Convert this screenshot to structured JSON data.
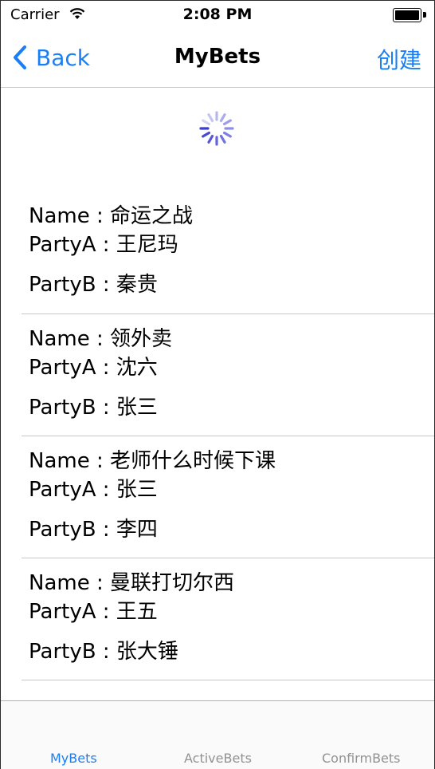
{
  "status_bar": {
    "carrier": "Carrier",
    "time": "2:08 PM",
    "wifi_icon": "wifi-icon",
    "battery_icon": "battery-icon"
  },
  "nav": {
    "back_label": "Back",
    "title": "MyBets",
    "action_label": "创建",
    "tint_color": "#1a7ff5"
  },
  "bets": [
    {
      "name_line": "Name : 命运之战",
      "party_a_line": "PartyA : 王尼玛",
      "party_b_line": "PartyB : 秦贵"
    },
    {
      "name_line": "Name : 领外卖",
      "party_a_line": "PartyA : 沈六",
      "party_b_line": "PartyB : 张三"
    },
    {
      "name_line": "Name : 老师什么时候下课",
      "party_a_line": "PartyA : 张三",
      "party_b_line": "PartyB : 李四"
    },
    {
      "name_line": "Name : 曼联打切尔西",
      "party_a_line": "PartyA : 王五",
      "party_b_line": "PartyB : 张大锤"
    }
  ],
  "tabs": [
    {
      "label": "MyBets",
      "active": true
    },
    {
      "label": "ActiveBets",
      "active": false
    },
    {
      "label": "ConfirmBets",
      "active": false
    }
  ],
  "colors": {
    "accent": "#1a7ff5",
    "tab_inactive": "#929292",
    "separator": "#c8c7cc",
    "spinner": "#3b3bd6"
  }
}
